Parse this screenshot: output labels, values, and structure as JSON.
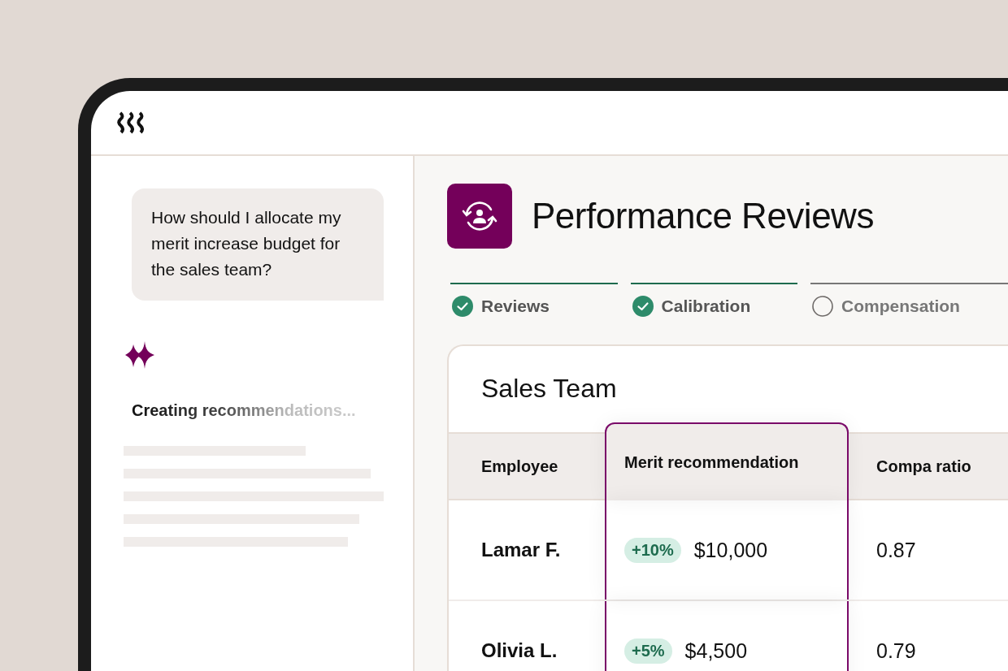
{
  "chat": {
    "prompt": "How should I allocate my merit increase budget for the sales team?",
    "status": "Creating recommendations..."
  },
  "app": {
    "title": "Performance Reviews"
  },
  "steps": [
    {
      "label": "Reviews",
      "done": true
    },
    {
      "label": "Calibration",
      "done": true
    },
    {
      "label": "Compensation",
      "done": false
    }
  ],
  "card": {
    "title": "Sales Team",
    "columns": [
      {
        "label": "Employee",
        "highlighted": false
      },
      {
        "label": "Merit recommendation",
        "highlighted": true
      },
      {
        "label": "Compa ratio",
        "highlighted": false
      }
    ],
    "rows": [
      {
        "employee": "Lamar F.",
        "percent": "+10%",
        "amount": "$10,000",
        "compa_ratio": "0.87"
      },
      {
        "employee": "Olivia L.",
        "percent": "+5%",
        "amount": "$4,500",
        "compa_ratio": "0.79"
      }
    ]
  }
}
